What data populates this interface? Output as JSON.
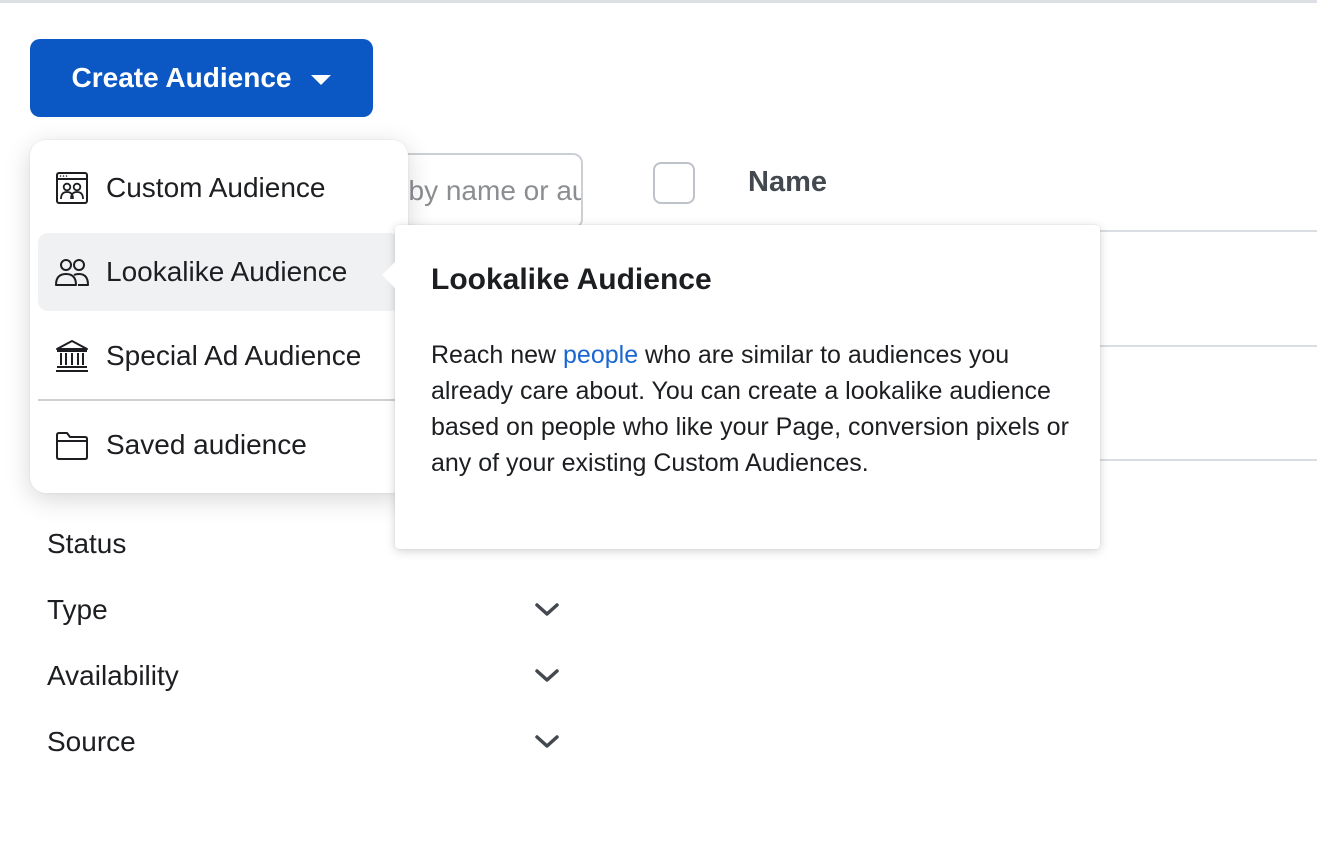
{
  "create_button": {
    "label": "Create Audience"
  },
  "search": {
    "placeholder": "Search by name or audience ID"
  },
  "table": {
    "header_name": "Name"
  },
  "dropdown": {
    "items": [
      {
        "label": "Custom Audience",
        "icon": "custom-audience-icon"
      },
      {
        "label": "Lookalike Audience",
        "icon": "lookalike-audience-icon",
        "active": true
      },
      {
        "label": "Special Ad Audience",
        "icon": "institution-icon"
      },
      {
        "label": "Saved audience",
        "icon": "folder-icon"
      }
    ]
  },
  "tooltip": {
    "title": "Lookalike Audience",
    "body_before_link": "Reach new ",
    "link_text": "people",
    "body_after_link": " who are similar to audiences you already care about. You can create a lookalike audience based on people who like your Page, conversion pixels or any of your existing Custom Audiences."
  },
  "filters": [
    {
      "label": "Status"
    },
    {
      "label": "Type"
    },
    {
      "label": "Availability"
    },
    {
      "label": "Source"
    }
  ],
  "colors": {
    "primary_button": "#0b58c4",
    "link": "#1a66d2",
    "menu_active_bg": "#f0f1f3"
  }
}
